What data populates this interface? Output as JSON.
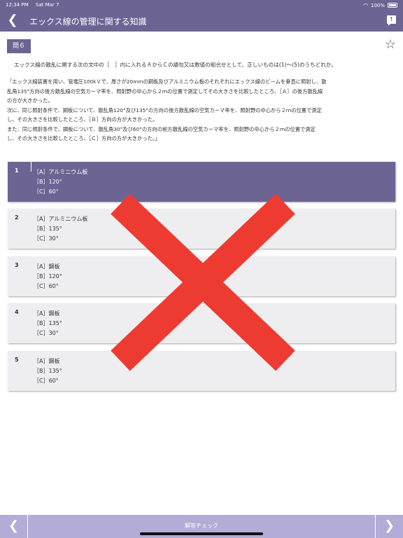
{
  "status_bar": {
    "time": "12:34 PM",
    "date": "Sat Mar 7",
    "battery": "100%"
  },
  "nav": {
    "back_glyph": "❮",
    "title": "エックス線の管理に関する知識",
    "comment_glyph": "!"
  },
  "question": {
    "number_label": "問６",
    "star_glyph": "☆",
    "intro": "エックス線の散乱に関する次の文中の［　］内に入れるＡからＣの語句又は数値の組合せとして、正しいものは(1)〜(5)のうちどれか。",
    "body_lines": [
      "「エックス線装置を用い、管電圧100kＶで、厚さが20mmの鋼板及びアルミニウム板のそれぞれにエックス線のビームを垂直に照射し、散",
      "乱角135°方向の後方散乱線の空気カーマ率を、照射野の中心から２ｍの位置で測定してその大きさを比較したところ、［Ａ］の後方散乱線",
      "の方が大きかった。",
      "次に、同じ照射条件で、鋼板について、散乱角120°及び135°の方向の後方散乱線の空気カーマ率を、照射野の中心から２ｍの位置で測定",
      "し、その大きさを比較したところ、［Ｂ］方向の方が大きかった。",
      "また、同じ照射条件で、鋼板について、散乱角30°及び60°の方向の前方散乱線の空気カーマ率を、照射野の中心から２ｍの位置で測定",
      "し、その大きさを比較したところ、［Ｃ］方向の方が大きかった。」"
    ]
  },
  "choices": [
    {
      "num": "1",
      "a": "［A］アルミニウム板",
      "b": "［B］120°",
      "c": "［C］60°"
    },
    {
      "num": "2",
      "a": "［A］アルミニウム板",
      "b": "［B］135°",
      "c": "［C］30°"
    },
    {
      "num": "3",
      "a": "［A］鋼板",
      "b": "［B］120°",
      "c": "［C］60°"
    },
    {
      "num": "4",
      "a": "［A］鋼板",
      "b": "［B］135°",
      "c": "［C］30°"
    },
    {
      "num": "5",
      "a": "［A］鋼板",
      "b": "［B］135°",
      "c": "［C］60°"
    }
  ],
  "selected_choice": "1",
  "result_mark": {
    "icon": "incorrect-x-icon",
    "color": "#ee3b32"
  },
  "bottom": {
    "prev_glyph": "❮",
    "check_label": "解答チェック",
    "next_glyph": "❯"
  },
  "colors": {
    "accent": "#6c6493",
    "bottom_bar": "#b3acd6",
    "choice_bg": "#eeeef0"
  }
}
